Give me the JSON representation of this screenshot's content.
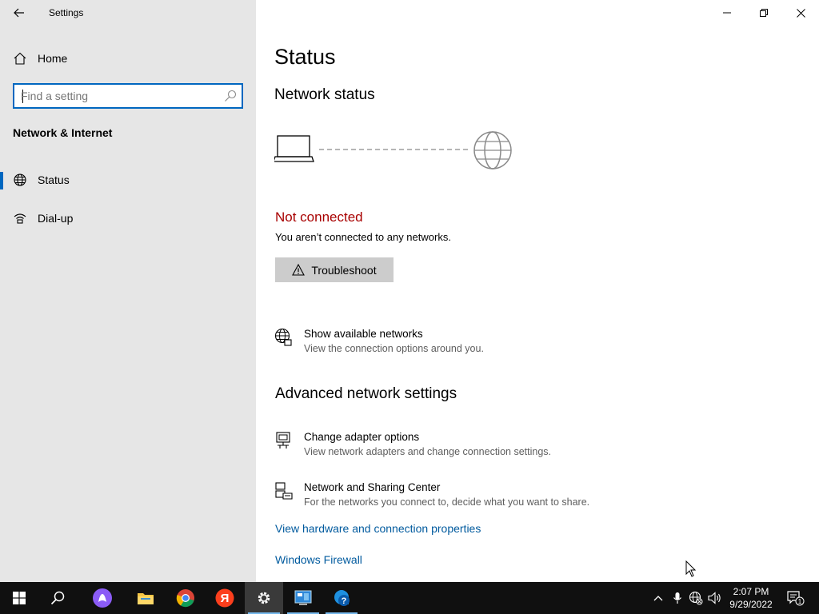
{
  "window": {
    "app_title": "Settings"
  },
  "sidebar": {
    "home_label": "Home",
    "search_placeholder": "Find a setting",
    "section_title": "Network & Internet",
    "items": [
      {
        "label": "Status",
        "icon": "globe-icon",
        "active": true
      },
      {
        "label": "Dial-up",
        "icon": "dial-up-icon",
        "active": false
      }
    ]
  },
  "main": {
    "title": "Status",
    "network_status_heading": "Network status",
    "connection_state": "Not connected",
    "connection_desc": "You aren’t connected to any networks.",
    "troubleshoot_label": "Troubleshoot",
    "show_networks": {
      "title": "Show available networks",
      "desc": "View the connection options around you."
    },
    "advanced_heading": "Advanced network settings",
    "change_adapter": {
      "title": "Change adapter options",
      "desc": "View network adapters and change connection settings."
    },
    "sharing_center": {
      "title": "Network and Sharing Center",
      "desc": "For the networks you connect to, decide what you want to share."
    },
    "hardware_link": "View hardware and connection properties",
    "firewall_link": "Windows Firewall"
  },
  "colors": {
    "accent": "#0067c0",
    "error": "#a80000",
    "link": "#005a9e",
    "sidebar_bg": "#e6e6e6",
    "taskbar_bg": "#101010"
  },
  "taskbar": {
    "apps": [
      "start-icon",
      "search-icon",
      "alice-assistant-icon",
      "file-explorer-icon",
      "chrome-icon",
      "yandex-browser-icon",
      "settings-gear-icon",
      "control-panel-icon",
      "help-icon"
    ],
    "clock_time": "2:07 PM",
    "clock_date": "9/29/2022",
    "notification_count": "1"
  }
}
